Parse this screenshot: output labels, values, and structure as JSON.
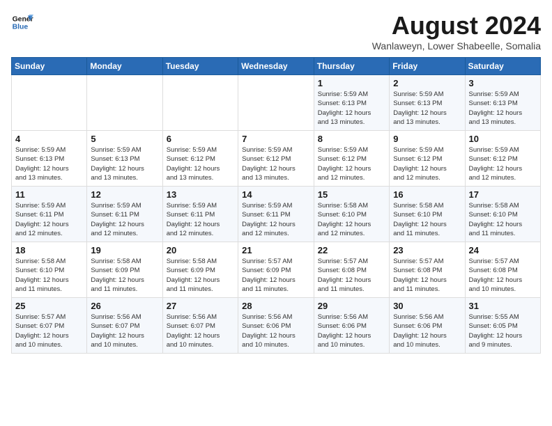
{
  "header": {
    "logo_line1": "General",
    "logo_line2": "Blue",
    "month": "August 2024",
    "location": "Wanlaweyn, Lower Shabeelle, Somalia"
  },
  "weekdays": [
    "Sunday",
    "Monday",
    "Tuesday",
    "Wednesday",
    "Thursday",
    "Friday",
    "Saturday"
  ],
  "weeks": [
    [
      {
        "day": "",
        "info": ""
      },
      {
        "day": "",
        "info": ""
      },
      {
        "day": "",
        "info": ""
      },
      {
        "day": "",
        "info": ""
      },
      {
        "day": "1",
        "info": "Sunrise: 5:59 AM\nSunset: 6:13 PM\nDaylight: 12 hours\nand 13 minutes."
      },
      {
        "day": "2",
        "info": "Sunrise: 5:59 AM\nSunset: 6:13 PM\nDaylight: 12 hours\nand 13 minutes."
      },
      {
        "day": "3",
        "info": "Sunrise: 5:59 AM\nSunset: 6:13 PM\nDaylight: 12 hours\nand 13 minutes."
      }
    ],
    [
      {
        "day": "4",
        "info": "Sunrise: 5:59 AM\nSunset: 6:13 PM\nDaylight: 12 hours\nand 13 minutes."
      },
      {
        "day": "5",
        "info": "Sunrise: 5:59 AM\nSunset: 6:13 PM\nDaylight: 12 hours\nand 13 minutes."
      },
      {
        "day": "6",
        "info": "Sunrise: 5:59 AM\nSunset: 6:12 PM\nDaylight: 12 hours\nand 13 minutes."
      },
      {
        "day": "7",
        "info": "Sunrise: 5:59 AM\nSunset: 6:12 PM\nDaylight: 12 hours\nand 13 minutes."
      },
      {
        "day": "8",
        "info": "Sunrise: 5:59 AM\nSunset: 6:12 PM\nDaylight: 12 hours\nand 12 minutes."
      },
      {
        "day": "9",
        "info": "Sunrise: 5:59 AM\nSunset: 6:12 PM\nDaylight: 12 hours\nand 12 minutes."
      },
      {
        "day": "10",
        "info": "Sunrise: 5:59 AM\nSunset: 6:12 PM\nDaylight: 12 hours\nand 12 minutes."
      }
    ],
    [
      {
        "day": "11",
        "info": "Sunrise: 5:59 AM\nSunset: 6:11 PM\nDaylight: 12 hours\nand 12 minutes."
      },
      {
        "day": "12",
        "info": "Sunrise: 5:59 AM\nSunset: 6:11 PM\nDaylight: 12 hours\nand 12 minutes."
      },
      {
        "day": "13",
        "info": "Sunrise: 5:59 AM\nSunset: 6:11 PM\nDaylight: 12 hours\nand 12 minutes."
      },
      {
        "day": "14",
        "info": "Sunrise: 5:59 AM\nSunset: 6:11 PM\nDaylight: 12 hours\nand 12 minutes."
      },
      {
        "day": "15",
        "info": "Sunrise: 5:58 AM\nSunset: 6:10 PM\nDaylight: 12 hours\nand 12 minutes."
      },
      {
        "day": "16",
        "info": "Sunrise: 5:58 AM\nSunset: 6:10 PM\nDaylight: 12 hours\nand 11 minutes."
      },
      {
        "day": "17",
        "info": "Sunrise: 5:58 AM\nSunset: 6:10 PM\nDaylight: 12 hours\nand 11 minutes."
      }
    ],
    [
      {
        "day": "18",
        "info": "Sunrise: 5:58 AM\nSunset: 6:10 PM\nDaylight: 12 hours\nand 11 minutes."
      },
      {
        "day": "19",
        "info": "Sunrise: 5:58 AM\nSunset: 6:09 PM\nDaylight: 12 hours\nand 11 minutes."
      },
      {
        "day": "20",
        "info": "Sunrise: 5:58 AM\nSunset: 6:09 PM\nDaylight: 12 hours\nand 11 minutes."
      },
      {
        "day": "21",
        "info": "Sunrise: 5:57 AM\nSunset: 6:09 PM\nDaylight: 12 hours\nand 11 minutes."
      },
      {
        "day": "22",
        "info": "Sunrise: 5:57 AM\nSunset: 6:08 PM\nDaylight: 12 hours\nand 11 minutes."
      },
      {
        "day": "23",
        "info": "Sunrise: 5:57 AM\nSunset: 6:08 PM\nDaylight: 12 hours\nand 11 minutes."
      },
      {
        "day": "24",
        "info": "Sunrise: 5:57 AM\nSunset: 6:08 PM\nDaylight: 12 hours\nand 10 minutes."
      }
    ],
    [
      {
        "day": "25",
        "info": "Sunrise: 5:57 AM\nSunset: 6:07 PM\nDaylight: 12 hours\nand 10 minutes."
      },
      {
        "day": "26",
        "info": "Sunrise: 5:56 AM\nSunset: 6:07 PM\nDaylight: 12 hours\nand 10 minutes."
      },
      {
        "day": "27",
        "info": "Sunrise: 5:56 AM\nSunset: 6:07 PM\nDaylight: 12 hours\nand 10 minutes."
      },
      {
        "day": "28",
        "info": "Sunrise: 5:56 AM\nSunset: 6:06 PM\nDaylight: 12 hours\nand 10 minutes."
      },
      {
        "day": "29",
        "info": "Sunrise: 5:56 AM\nSunset: 6:06 PM\nDaylight: 12 hours\nand 10 minutes."
      },
      {
        "day": "30",
        "info": "Sunrise: 5:56 AM\nSunset: 6:06 PM\nDaylight: 12 hours\nand 10 minutes."
      },
      {
        "day": "31",
        "info": "Sunrise: 5:55 AM\nSunset: 6:05 PM\nDaylight: 12 hours\nand 9 minutes."
      }
    ]
  ]
}
